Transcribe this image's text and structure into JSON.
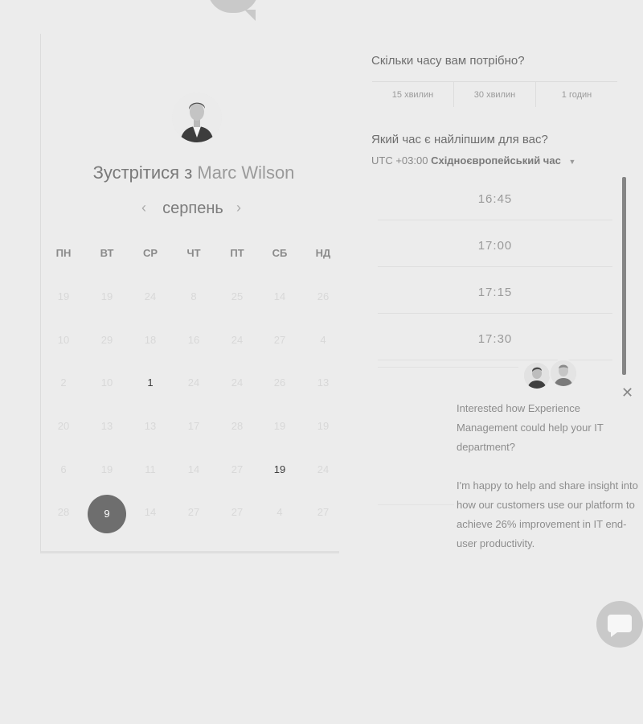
{
  "meeting": {
    "title_prefix": "Зустрітися з",
    "host_name": "Marc Wilson"
  },
  "calendar": {
    "month": "серпень",
    "weekdays": [
      "ПН",
      "ВТ",
      "СР",
      "ЧТ",
      "ПТ",
      "СБ",
      "НД"
    ],
    "weeks": [
      [
        "19",
        "19",
        "24",
        "8",
        "25",
        "14",
        "26"
      ],
      [
        "10",
        "29",
        "18",
        "16",
        "24",
        "27",
        "4"
      ],
      [
        "2",
        "10",
        "1",
        "24",
        "24",
        "26",
        "13"
      ],
      [
        "20",
        "13",
        "13",
        "17",
        "28",
        "19",
        "19"
      ],
      [
        "6",
        "19",
        "11",
        "14",
        "27",
        "19",
        "24"
      ],
      [
        "28",
        "9",
        "14",
        "27",
        "27",
        "4",
        "27"
      ]
    ],
    "available": [
      [
        2,
        2
      ],
      [
        4,
        5
      ]
    ],
    "selected": [
      5,
      1
    ]
  },
  "duration": {
    "title": "Скільки часу вам потрібно?",
    "options": [
      "15 хвилин",
      "30 хвилин",
      "1 годин"
    ]
  },
  "time": {
    "title": "Який час є найліпшим для вас?",
    "tz_offset": "UTC +03:00",
    "tz_name": "Східноєвропейський час",
    "slots": [
      "16:45",
      "17:00",
      "17:15",
      "17:30"
    ]
  },
  "chat": {
    "message1": "Interested how Experience Management could help your IT department?",
    "message2": "I'm happy to help and share insight into how our customers use our platform to achieve 26% improvement in IT end-user productivity."
  },
  "icons": {
    "prev": "chevron-left-icon",
    "next": "chevron-right-icon",
    "close": "close-icon",
    "chat": "chat-bubble-icon",
    "tz_caret": "caret-down-icon"
  }
}
